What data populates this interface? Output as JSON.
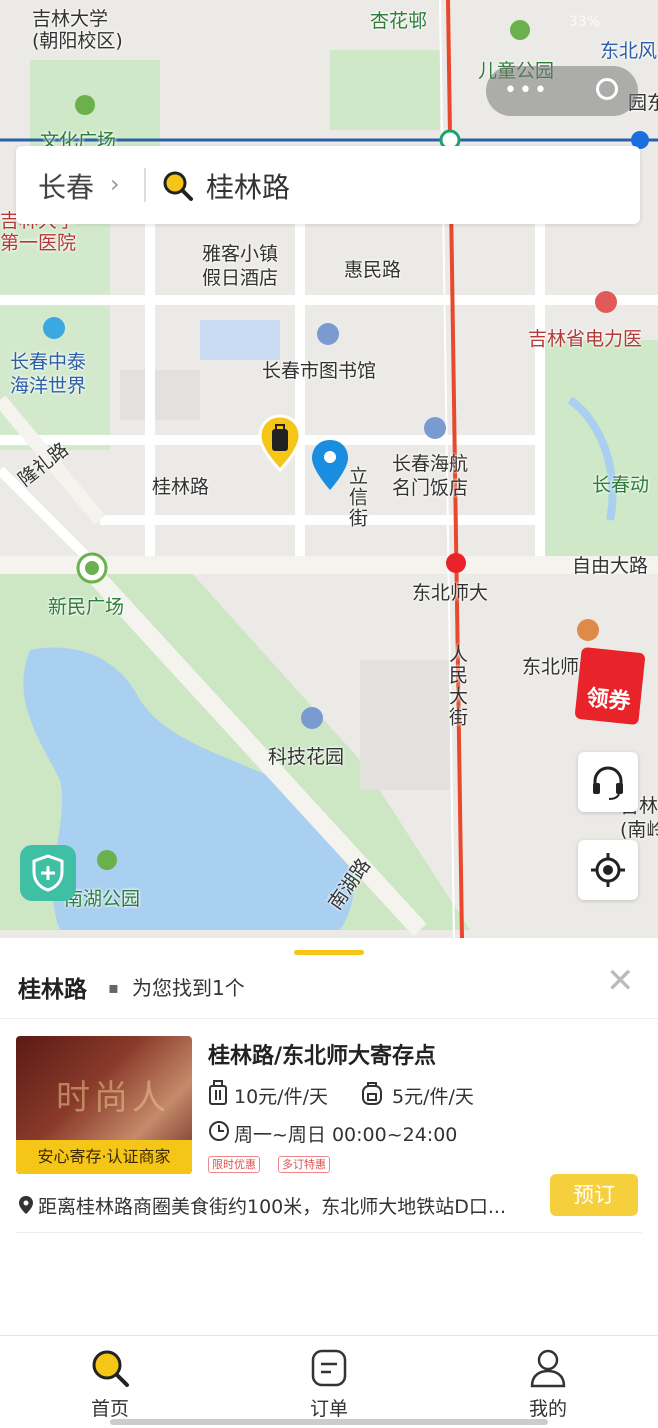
{
  "status": {
    "battery": "33%"
  },
  "map": {
    "labels": {
      "jilin_univ": "吉林大学\n(朝阳校区)",
      "xinghua": "杏花邨",
      "children_park": "儿童公园",
      "dongbei_feng": "东北风",
      "yuan": "园东",
      "wenhua": "文化广场",
      "shida_hosp": "吉林大学\n第一医院",
      "yake": "雅客小镇\n假日酒店",
      "huimin": "惠民路",
      "electric_hosp": "吉林省电力医",
      "zhongtai": "长春中泰\n海洋世界",
      "library": "长春市图书馆",
      "longli": "隆礼路",
      "guilin_road_map": "桂林路",
      "lixin": "立信街",
      "haihang": "长春海航\n名门饭店",
      "changchun_dong": "长春动",
      "ziyou": "自由大路",
      "xinmin": "新民广场",
      "dongbei_shida": "东北师大",
      "dongbei_shi_xue": "东北师大学",
      "renmin": "人民大街",
      "keji": "科技花园",
      "jilin_nan": "吉林\n(南岭",
      "nanhu": "南湖公园",
      "nanhu_road": "南湖路"
    },
    "coupon_label": "领券"
  },
  "search": {
    "city": "长春",
    "query": "桂林路"
  },
  "results": {
    "title": "桂林路",
    "count_text": "为您找到1个",
    "item": {
      "name": "桂林路/东北师大寄存点",
      "price_large": "10元/件/天",
      "price_small": "5元/件/天",
      "hours": "周一~周日 00:00~24:00",
      "tag1": "限时优惠",
      "tag2": "多订特惠",
      "badge": "安心寄存·认证商家",
      "thumb_text": "时尚人",
      "address": "距离桂林路商圈美食街约100米，东北师大地铁站D口...",
      "book_label": "预订"
    }
  },
  "tabs": [
    {
      "label": "首页",
      "icon": "search-icon"
    },
    {
      "label": "订单",
      "icon": "order-icon"
    },
    {
      "label": "我的",
      "icon": "user-icon"
    }
  ],
  "colors": {
    "accent": "#f5c518",
    "book": "#f5cf3c",
    "pin": "#1a8de0",
    "road_red": "#e8492d"
  }
}
